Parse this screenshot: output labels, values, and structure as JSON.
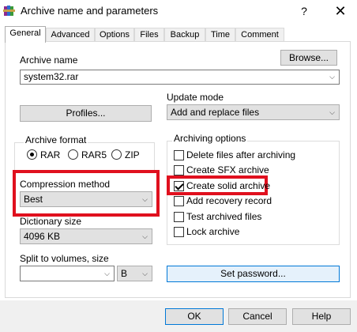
{
  "window": {
    "title": "Archive name and parameters",
    "help_glyph": "?",
    "close_glyph": "✕"
  },
  "tabs": [
    {
      "label": "General",
      "active": true
    },
    {
      "label": "Advanced"
    },
    {
      "label": "Options"
    },
    {
      "label": "Files"
    },
    {
      "label": "Backup"
    },
    {
      "label": "Time"
    },
    {
      "label": "Comment"
    }
  ],
  "archive_name": {
    "label": "Archive name",
    "value": "system32.rar",
    "browse_label": "Browse..."
  },
  "profiles_label": "Profiles...",
  "update_mode": {
    "label": "Update mode",
    "value": "Add and replace files"
  },
  "archive_format": {
    "legend": "Archive format",
    "options": [
      "RAR",
      "RAR5",
      "ZIP"
    ],
    "selected": "RAR"
  },
  "compression": {
    "label": "Compression method",
    "value": "Best"
  },
  "dictionary": {
    "label": "Dictionary size",
    "value": "4096 KB"
  },
  "split": {
    "label": "Split to volumes, size",
    "value": "",
    "unit": "B"
  },
  "archiving_options": {
    "legend": "Archiving options",
    "items": [
      {
        "label": "Delete files after archiving",
        "checked": false
      },
      {
        "label": "Create SFX archive",
        "checked": false
      },
      {
        "label": "Create solid archive",
        "checked": true
      },
      {
        "label": "Add recovery record",
        "checked": false
      },
      {
        "label": "Test archived files",
        "checked": false
      },
      {
        "label": "Lock archive",
        "checked": false
      }
    ]
  },
  "set_password_label": "Set password...",
  "buttons": {
    "ok": "OK",
    "cancel": "Cancel",
    "help": "Help"
  },
  "colors": {
    "highlight": "#e0101e",
    "accent": "#0078d7",
    "button_face": "#e1e1e1"
  },
  "icons": {
    "app": "winrar-books-icon",
    "dropdown": "chevron-down-icon"
  }
}
